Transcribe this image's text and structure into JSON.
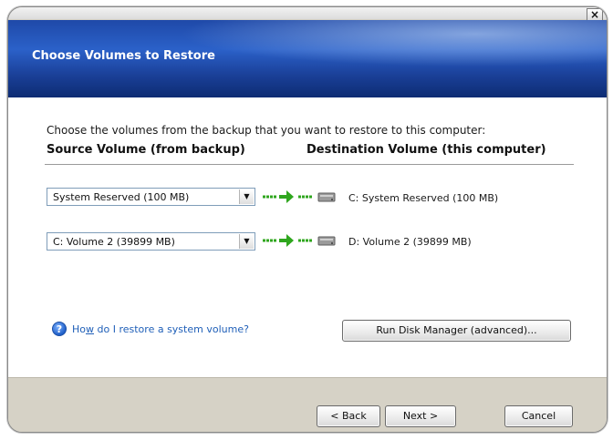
{
  "window": {
    "close_glyph": "×"
  },
  "header": {
    "title": "Choose Volumes to Restore"
  },
  "main": {
    "instruction": "Choose the volumes from the backup that you want to restore to this computer:",
    "columns": {
      "source": "Source Volume (from backup)",
      "destination": "Destination Volume (this computer)"
    },
    "rows": [
      {
        "source": "System Reserved (100 MB)",
        "destination": "C: System Reserved (100 MB)"
      },
      {
        "source": "C: Volume 2 (39899 MB)",
        "destination": "D: Volume 2 (39899 MB)"
      }
    ],
    "help": {
      "icon": "question-icon",
      "link_before": "Ho",
      "link_accel": "w",
      "link_after": " do I restore a system volume?"
    },
    "disk_manager_button": "Run Disk Manager (advanced)..."
  },
  "footer": {
    "back_label": "< Back",
    "next_label": "Next >",
    "cancel_label": "Cancel"
  },
  "colors": {
    "banner": "#2b61c9",
    "link": "#1f5fb8",
    "arrow": "#2fa61e",
    "footer": "#d6d2c6"
  },
  "icons": [
    "close-icon",
    "dropdown-arrow-icon",
    "green-arrow-icon",
    "drive-icon",
    "question-icon"
  ]
}
